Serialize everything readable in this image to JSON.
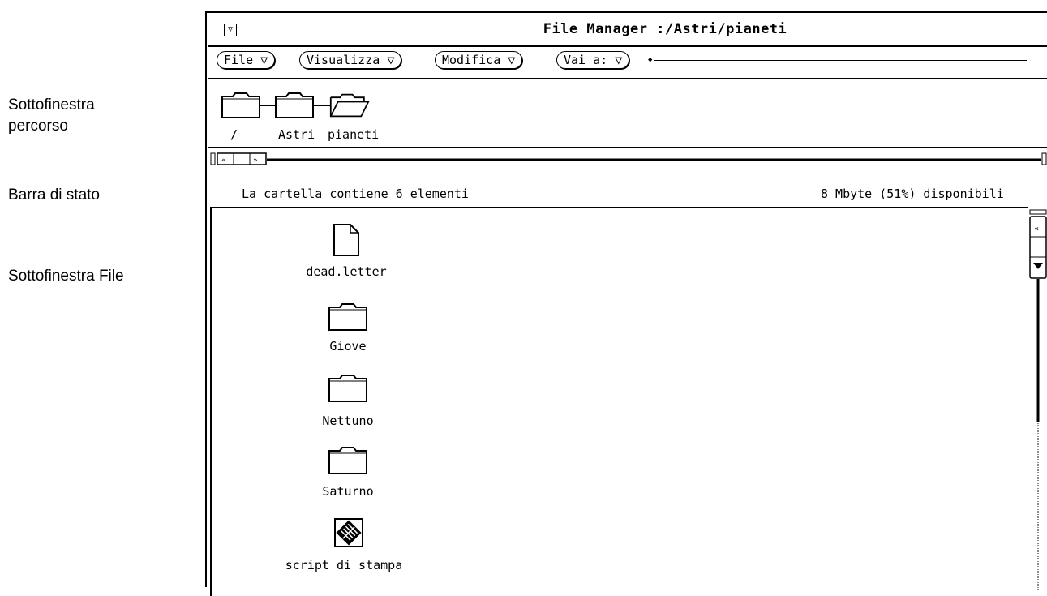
{
  "callouts": {
    "path_pane_line1": "Sottofinestra",
    "path_pane_line2": "percorso",
    "status_bar": "Barra di stato",
    "file_pane": "Sottofinestra File"
  },
  "window": {
    "title": "File Manager :/Astri/pianeti",
    "menu_glyph": "▽"
  },
  "menus": [
    {
      "label": "File ▽"
    },
    {
      "label": "Visualizza ▽"
    },
    {
      "label": "Modifica ▽"
    },
    {
      "label": "Vai a: ▽"
    }
  ],
  "path": [
    {
      "label": "/",
      "icon": "folder-closed-icon"
    },
    {
      "label": "Astri",
      "icon": "folder-closed-icon"
    },
    {
      "label": "pianeti",
      "icon": "folder-open-icon"
    }
  ],
  "status": {
    "left": "La cartella contiene 6 elementi",
    "right": "8 Mbyte (51%) disponibili"
  },
  "files": [
    {
      "name": "dead.letter",
      "icon": "document-icon"
    },
    {
      "name": "Giove",
      "icon": "folder-icon"
    },
    {
      "name": "Nettuno",
      "icon": "folder-icon"
    },
    {
      "name": "Saturno",
      "icon": "folder-icon"
    },
    {
      "name": "script_di_stampa",
      "icon": "script-icon"
    }
  ]
}
